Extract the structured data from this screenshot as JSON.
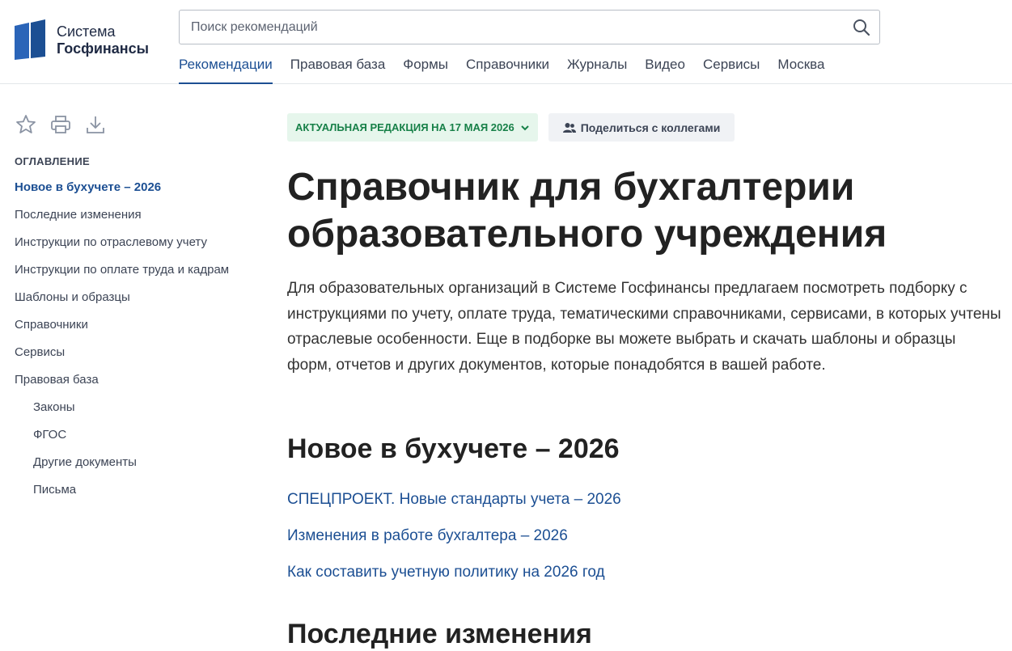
{
  "logo": {
    "line1": "Система",
    "line2": "Госфинансы",
    "brand_color": "#1c4f93"
  },
  "search": {
    "placeholder": "Поиск рекомендаций",
    "value": "",
    "icon": "search-icon"
  },
  "nav": {
    "items": [
      {
        "label": "Рекомендации",
        "active": true
      },
      {
        "label": "Правовая база"
      },
      {
        "label": "Формы"
      },
      {
        "label": "Справочники"
      },
      {
        "label": "Журналы"
      },
      {
        "label": "Видео"
      },
      {
        "label": "Сервисы"
      },
      {
        "label": "Москва"
      }
    ]
  },
  "tools": [
    "star-icon",
    "print-icon",
    "download-icon"
  ],
  "toc": {
    "title": "ОГЛАВЛЕНИЕ",
    "items": [
      {
        "label": "Новое в бухучете – 2026",
        "active": true
      },
      {
        "label": "Последние изменения"
      },
      {
        "label": "Инструкции по отраслевому учету"
      },
      {
        "label": "Инструкции по оплате труда и кадрам"
      },
      {
        "label": "Шаблоны и образцы"
      },
      {
        "label": "Справочники"
      },
      {
        "label": "Сервисы"
      },
      {
        "label": "Правовая база"
      },
      {
        "label": "Законы",
        "sub": true
      },
      {
        "label": "ФГОС",
        "sub": true
      },
      {
        "label": "Другие документы",
        "sub": true
      },
      {
        "label": "Письма",
        "sub": true
      }
    ]
  },
  "main": {
    "edition_badge": "АКТУАЛЬНАЯ РЕДАКЦИЯ НА 17 МАЯ 2026",
    "share_button": "Поделиться с коллегами",
    "title": "Справочник для бухгалтерии образовательного учреждения",
    "intro": "Для образовательных организаций в Системе Госфинансы предлагаем посмотреть подборку с инструкциями по учету, оплате труда, тематическими справочниками, сервисами, в которых учтены отраслевые особенности. Еще в подборке вы можете выбрать и скачать шаблоны и образцы форм, отчетов и других документов, которые понадобятся в вашей работе.",
    "sections": [
      {
        "heading": "Новое в бухучете – 2026",
        "links": [
          "СПЕЦПРОЕКТ. Новые стандарты учета – 2026",
          "Изменения в работе бухгалтера – 2026",
          "Как составить учетную политику на 2026 год"
        ]
      },
      {
        "heading": "Последние изменения"
      }
    ]
  },
  "colors": {
    "link": "#1c4f93",
    "text": "#222222",
    "edition_bg": "#e6f6ec",
    "edition_text": "#178048"
  }
}
